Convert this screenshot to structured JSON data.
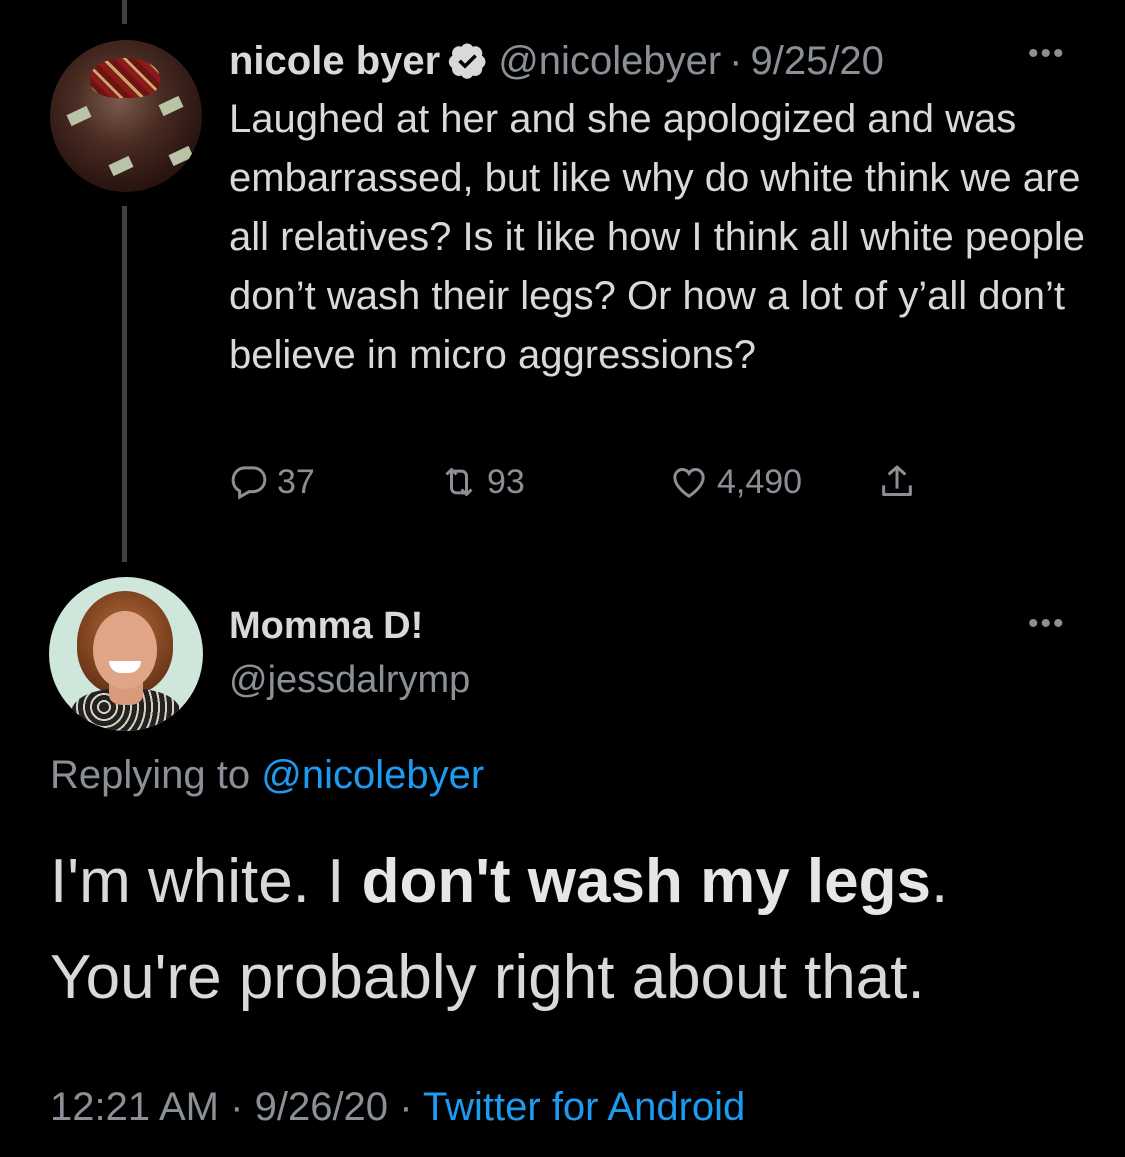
{
  "tweet": {
    "author_name": "nicole byer",
    "author_handle": "@nicolebyer",
    "separator": "·",
    "date": "9/25/20",
    "more_label": "•••",
    "text": "Laughed at her and she apologized and was embarrassed, but like why do white think we are all relatives? Is it like how I think all white people don’t wash their legs? Or how a lot of y’all don’t believe in micro aggressions?",
    "verified_icon": "verified-badge-icon",
    "actions": {
      "reply_count": "37",
      "retweet_count": "93",
      "like_count": "4,490"
    }
  },
  "reply": {
    "author_name": "Momma D!",
    "author_handle": "@jessdalrymp",
    "more_label": "•••",
    "replying_prefix": "Replying to",
    "replying_mention": "@nicolebyer",
    "text_part1": "I'm white. I ",
    "text_bold": "don't wash my legs",
    "text_part2": ".",
    "text_line2": "You're probably right about that.",
    "time": "12:21 AM",
    "separator": "·",
    "date": "9/26/20",
    "source": "Twitter for Android"
  },
  "colors": {
    "background": "#000000",
    "text": "#d9d9d9",
    "secondary": "#8b9096",
    "link": "#1d9bf0",
    "thread_line": "#3d4145"
  }
}
